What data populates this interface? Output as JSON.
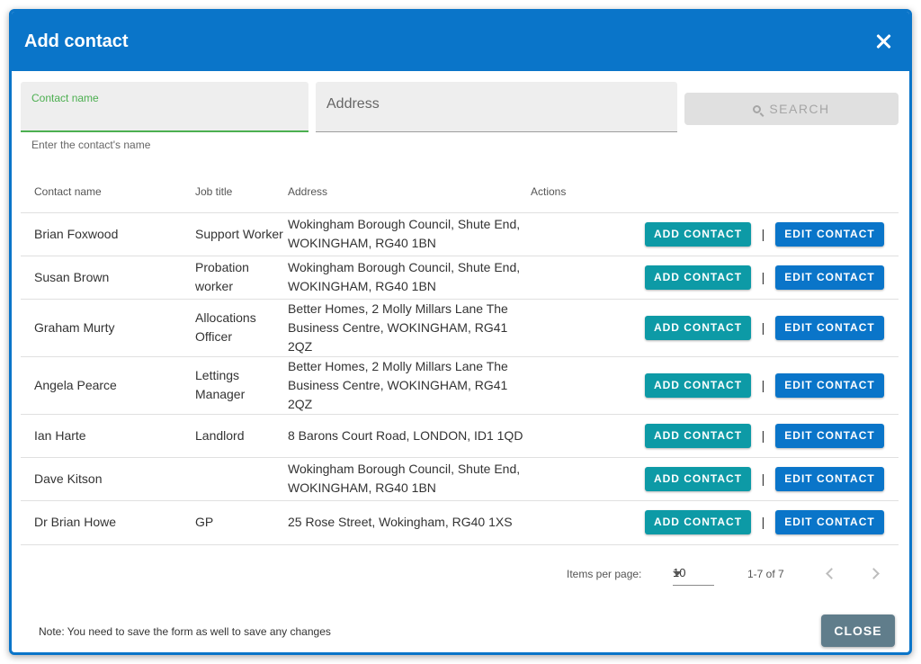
{
  "dialog": {
    "title": "Add contact",
    "close_icon": "close-icon"
  },
  "search": {
    "name_label": "Contact name",
    "name_value": "",
    "name_hint": "Enter the contact's name",
    "address_placeholder": "Address",
    "address_value": "",
    "button_label": "SEARCH",
    "button_icon": "search-icon"
  },
  "table": {
    "headers": {
      "name": "Contact name",
      "job": "Job title",
      "address": "Address",
      "actions": "Actions"
    },
    "rows": [
      {
        "name": "Brian Foxwood",
        "job": "Support Worker",
        "address": "Wokingham Borough Council, Shute End, WOKINGHAM, RG40 1BN"
      },
      {
        "name": "Susan Brown",
        "job": "Probation worker",
        "address": "Wokingham Borough Council, Shute End, WOKINGHAM, RG40 1BN"
      },
      {
        "name": "Graham Murty",
        "job": "Allocations Officer",
        "address": "Better Homes, 2 Molly Millars Lane The Business Centre, WOKINGHAM, RG41 2QZ"
      },
      {
        "name": "Angela Pearce",
        "job": "Lettings Manager",
        "address": "Better Homes, 2 Molly Millars Lane The Business Centre, WOKINGHAM, RG41 2QZ"
      },
      {
        "name": "Ian Harte",
        "job": "Landlord",
        "address": "8 Barons Court Road, LONDON, ID1 1QD"
      },
      {
        "name": "Dave Kitson",
        "job": "",
        "address": "Wokingham Borough Council, Shute End, WOKINGHAM, RG40 1BN"
      },
      {
        "name": "Dr Brian Howe",
        "job": "GP",
        "address": "25 Rose Street, Wokingham, RG40 1XS"
      }
    ],
    "add_label": "ADD CONTACT",
    "separator": "|",
    "edit_label": "EDIT CONTACT"
  },
  "paginator": {
    "items_per_page_label": "Items per page:",
    "page_size": "10",
    "range": "1-7 of 7",
    "prev_icon": "chevron-left-icon",
    "next_icon": "chevron-right-icon"
  },
  "footer": {
    "note": "Note: You need to save the form as well to save any changes",
    "close_label": "CLOSE"
  },
  "colors": {
    "header": "#0a75c9",
    "add_button": "#0d9aa6",
    "edit_button": "#0a75c9",
    "close_button": "#607d8b",
    "focus_green": "#4caf50"
  }
}
